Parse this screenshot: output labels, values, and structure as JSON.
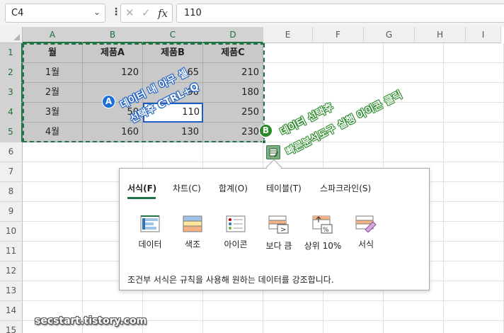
{
  "formula_bar": {
    "name_box": "C4",
    "name_box_dropdown": "⌄",
    "more": "⋮",
    "cancel": "✕",
    "enter": "✓",
    "fx": "fx",
    "value": "110"
  },
  "columns": [
    "A",
    "B",
    "C",
    "D",
    "E",
    "F",
    "G",
    "H",
    "I"
  ],
  "rows": [
    "1",
    "2",
    "3",
    "4",
    "5",
    "6",
    "7",
    "8",
    "9",
    "10",
    "11",
    "12",
    "13",
    "14",
    "15"
  ],
  "table": {
    "header": [
      "월",
      "제품A",
      "제품B",
      "제품C"
    ],
    "rows": [
      [
        "1월",
        "120",
        "65",
        "210"
      ],
      [
        "2월",
        "",
        "90",
        "180"
      ],
      [
        "3월",
        "50",
        "110",
        "250"
      ],
      [
        "4월",
        "160",
        "130",
        "230"
      ]
    ],
    "active_cell": "C4"
  },
  "quick_analysis": {
    "tabs": [
      "서식(F)",
      "차트(C)",
      "합계(O)",
      "테이블(T)",
      "스파크라인(S)"
    ],
    "active_tab": "서식(F)",
    "options": [
      "데이터",
      "색조",
      "아이콘",
      "보다 큼",
      "상위 10%",
      "서식"
    ],
    "description": "조건부 서식은 규칙을 사용해 원하는 데이터를 강조합니다."
  },
  "annotations": {
    "a_badge": "A",
    "a_line1": "데이터 내 아무 셀",
    "a_line2": "선택후 CTRL+Q",
    "b_badge": "B",
    "b_line1": "데이터 선택후",
    "b_line2": "빠른분석도구 실행 아이콘 클릭"
  },
  "watermark": "secstart.tistory.com",
  "colors": {
    "selection_border": "#217346",
    "selected_fill": "#c9c9c9",
    "active_cell_border": "#1f5ec7",
    "annotation_a": "#1b6fd6",
    "annotation_b": "#2a8a2a"
  }
}
